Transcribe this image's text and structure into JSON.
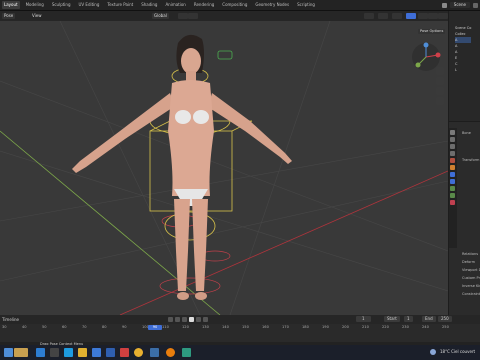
{
  "topbar": {
    "tabs": [
      "Layout",
      "Modeling",
      "Sculpting",
      "UV Editing",
      "Texture Paint",
      "Shading",
      "Animation",
      "Rendering",
      "Compositing",
      "Geometry Nodes",
      "Scripting"
    ],
    "active_tab": 0,
    "scene": "Scene"
  },
  "view_header": {
    "mode": "Pose",
    "orientation": "Global",
    "pose_options": "Pose Options"
  },
  "outliner": {
    "items": [
      "Scene Co",
      "Collec",
      "A",
      "A",
      "A",
      "E",
      "C",
      "L"
    ]
  },
  "properties": {
    "rows": [
      "Bone",
      "Transform",
      "",
      "",
      "",
      "",
      "",
      "",
      "Relations",
      "Deform",
      "Viewport Display",
      "Custom Properties",
      "Inverse Kinematics",
      "Constraints"
    ],
    "active": 0
  },
  "timeline": {
    "menu": "Timeline",
    "ticks": [
      "30",
      "40",
      "50",
      "60",
      "70",
      "80",
      "90",
      "100",
      "110",
      "120",
      "130",
      "140",
      "150",
      "160",
      "170",
      "180",
      "190",
      "200",
      "210",
      "220",
      "230",
      "240",
      "250"
    ],
    "current_frame": "1",
    "start_label": "Start",
    "start_value": "1",
    "end_label": "End",
    "end_value": "250"
  },
  "status": {
    "hint": "Drag  Pose Context Menu"
  },
  "taskbar": {
    "weather": "18°C  Ciel couvert"
  },
  "colors": {
    "viewport_bg": "#393939",
    "accent": "#3f6ed7",
    "grid_red": "#b0343c",
    "grid_green": "#7da84a",
    "rig_yellow": "#d8c24a"
  }
}
